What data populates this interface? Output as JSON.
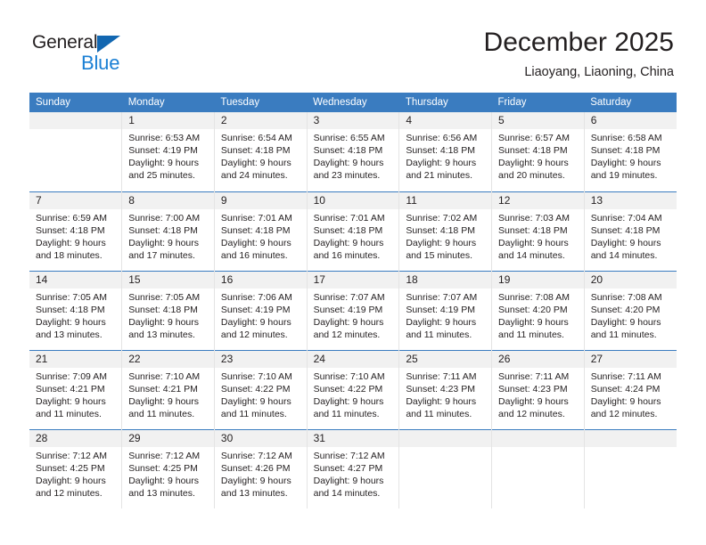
{
  "logo": {
    "word_one": "General",
    "word_two": "Blue",
    "triangle_icon": "triangle-icon",
    "accent_dark": "#231f20",
    "accent_blue": "#1a7fd4",
    "triangle_color": "#1267b1"
  },
  "header": {
    "title": "December 2025",
    "subtitle": "Liaoyang, Liaoning, China"
  },
  "colors": {
    "header_row_bg": "#3a7cc0",
    "header_row_text": "#ffffff",
    "daynum_band": "#f1f1f1",
    "cell_divider": "#e4e4e4",
    "week_divider": "#3a7cc0"
  },
  "weekday_headers": [
    "Sunday",
    "Monday",
    "Tuesday",
    "Wednesday",
    "Thursday",
    "Friday",
    "Saturday"
  ],
  "weeks": [
    [
      {
        "day": "",
        "lines": []
      },
      {
        "day": "1",
        "lines": [
          "Sunrise: 6:53 AM",
          "Sunset: 4:19 PM",
          "Daylight: 9 hours",
          "and 25 minutes."
        ]
      },
      {
        "day": "2",
        "lines": [
          "Sunrise: 6:54 AM",
          "Sunset: 4:18 PM",
          "Daylight: 9 hours",
          "and 24 minutes."
        ]
      },
      {
        "day": "3",
        "lines": [
          "Sunrise: 6:55 AM",
          "Sunset: 4:18 PM",
          "Daylight: 9 hours",
          "and 23 minutes."
        ]
      },
      {
        "day": "4",
        "lines": [
          "Sunrise: 6:56 AM",
          "Sunset: 4:18 PM",
          "Daylight: 9 hours",
          "and 21 minutes."
        ]
      },
      {
        "day": "5",
        "lines": [
          "Sunrise: 6:57 AM",
          "Sunset: 4:18 PM",
          "Daylight: 9 hours",
          "and 20 minutes."
        ]
      },
      {
        "day": "6",
        "lines": [
          "Sunrise: 6:58 AM",
          "Sunset: 4:18 PM",
          "Daylight: 9 hours",
          "and 19 minutes."
        ]
      }
    ],
    [
      {
        "day": "7",
        "lines": [
          "Sunrise: 6:59 AM",
          "Sunset: 4:18 PM",
          "Daylight: 9 hours",
          "and 18 minutes."
        ]
      },
      {
        "day": "8",
        "lines": [
          "Sunrise: 7:00 AM",
          "Sunset: 4:18 PM",
          "Daylight: 9 hours",
          "and 17 minutes."
        ]
      },
      {
        "day": "9",
        "lines": [
          "Sunrise: 7:01 AM",
          "Sunset: 4:18 PM",
          "Daylight: 9 hours",
          "and 16 minutes."
        ]
      },
      {
        "day": "10",
        "lines": [
          "Sunrise: 7:01 AM",
          "Sunset: 4:18 PM",
          "Daylight: 9 hours",
          "and 16 minutes."
        ]
      },
      {
        "day": "11",
        "lines": [
          "Sunrise: 7:02 AM",
          "Sunset: 4:18 PM",
          "Daylight: 9 hours",
          "and 15 minutes."
        ]
      },
      {
        "day": "12",
        "lines": [
          "Sunrise: 7:03 AM",
          "Sunset: 4:18 PM",
          "Daylight: 9 hours",
          "and 14 minutes."
        ]
      },
      {
        "day": "13",
        "lines": [
          "Sunrise: 7:04 AM",
          "Sunset: 4:18 PM",
          "Daylight: 9 hours",
          "and 14 minutes."
        ]
      }
    ],
    [
      {
        "day": "14",
        "lines": [
          "Sunrise: 7:05 AM",
          "Sunset: 4:18 PM",
          "Daylight: 9 hours",
          "and 13 minutes."
        ]
      },
      {
        "day": "15",
        "lines": [
          "Sunrise: 7:05 AM",
          "Sunset: 4:18 PM",
          "Daylight: 9 hours",
          "and 13 minutes."
        ]
      },
      {
        "day": "16",
        "lines": [
          "Sunrise: 7:06 AM",
          "Sunset: 4:19 PM",
          "Daylight: 9 hours",
          "and 12 minutes."
        ]
      },
      {
        "day": "17",
        "lines": [
          "Sunrise: 7:07 AM",
          "Sunset: 4:19 PM",
          "Daylight: 9 hours",
          "and 12 minutes."
        ]
      },
      {
        "day": "18",
        "lines": [
          "Sunrise: 7:07 AM",
          "Sunset: 4:19 PM",
          "Daylight: 9 hours",
          "and 11 minutes."
        ]
      },
      {
        "day": "19",
        "lines": [
          "Sunrise: 7:08 AM",
          "Sunset: 4:20 PM",
          "Daylight: 9 hours",
          "and 11 minutes."
        ]
      },
      {
        "day": "20",
        "lines": [
          "Sunrise: 7:08 AM",
          "Sunset: 4:20 PM",
          "Daylight: 9 hours",
          "and 11 minutes."
        ]
      }
    ],
    [
      {
        "day": "21",
        "lines": [
          "Sunrise: 7:09 AM",
          "Sunset: 4:21 PM",
          "Daylight: 9 hours",
          "and 11 minutes."
        ]
      },
      {
        "day": "22",
        "lines": [
          "Sunrise: 7:10 AM",
          "Sunset: 4:21 PM",
          "Daylight: 9 hours",
          "and 11 minutes."
        ]
      },
      {
        "day": "23",
        "lines": [
          "Sunrise: 7:10 AM",
          "Sunset: 4:22 PM",
          "Daylight: 9 hours",
          "and 11 minutes."
        ]
      },
      {
        "day": "24",
        "lines": [
          "Sunrise: 7:10 AM",
          "Sunset: 4:22 PM",
          "Daylight: 9 hours",
          "and 11 minutes."
        ]
      },
      {
        "day": "25",
        "lines": [
          "Sunrise: 7:11 AM",
          "Sunset: 4:23 PM",
          "Daylight: 9 hours",
          "and 11 minutes."
        ]
      },
      {
        "day": "26",
        "lines": [
          "Sunrise: 7:11 AM",
          "Sunset: 4:23 PM",
          "Daylight: 9 hours",
          "and 12 minutes."
        ]
      },
      {
        "day": "27",
        "lines": [
          "Sunrise: 7:11 AM",
          "Sunset: 4:24 PM",
          "Daylight: 9 hours",
          "and 12 minutes."
        ]
      }
    ],
    [
      {
        "day": "28",
        "lines": [
          "Sunrise: 7:12 AM",
          "Sunset: 4:25 PM",
          "Daylight: 9 hours",
          "and 12 minutes."
        ]
      },
      {
        "day": "29",
        "lines": [
          "Sunrise: 7:12 AM",
          "Sunset: 4:25 PM",
          "Daylight: 9 hours",
          "and 13 minutes."
        ]
      },
      {
        "day": "30",
        "lines": [
          "Sunrise: 7:12 AM",
          "Sunset: 4:26 PM",
          "Daylight: 9 hours",
          "and 13 minutes."
        ]
      },
      {
        "day": "31",
        "lines": [
          "Sunrise: 7:12 AM",
          "Sunset: 4:27 PM",
          "Daylight: 9 hours",
          "and 14 minutes."
        ]
      },
      {
        "day": "",
        "lines": []
      },
      {
        "day": "",
        "lines": []
      },
      {
        "day": "",
        "lines": []
      }
    ]
  ]
}
